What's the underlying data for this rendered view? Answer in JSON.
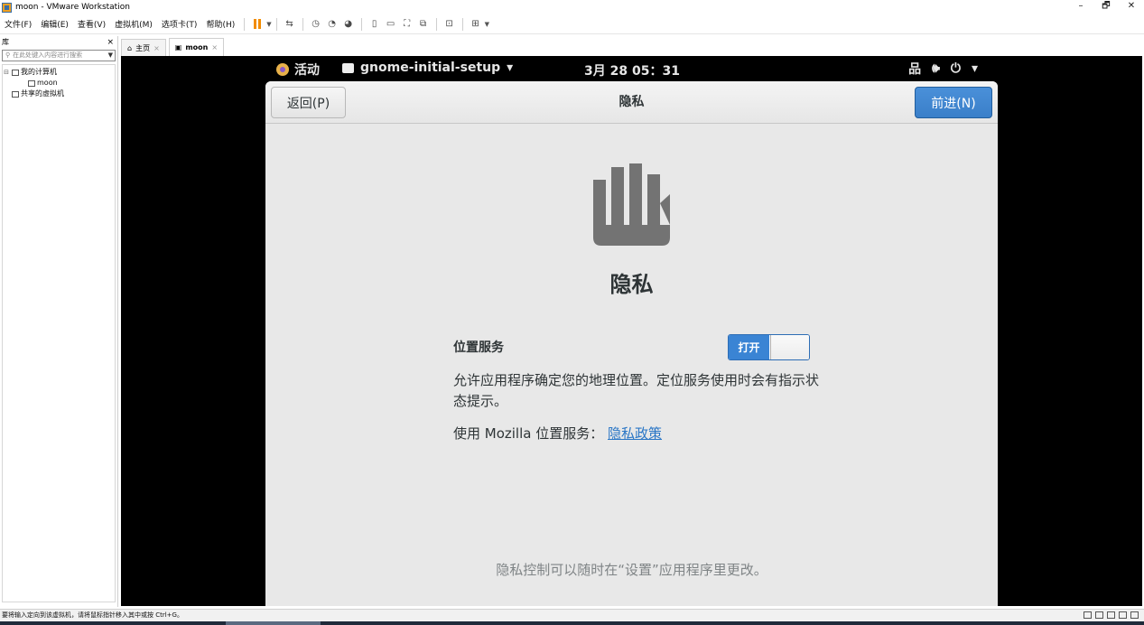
{
  "window": {
    "title": "moon - VMware Workstation",
    "controls": [
      "–",
      "🗗",
      "✕"
    ]
  },
  "menu": {
    "items": [
      "文件(F)",
      "编辑(E)",
      "查看(V)",
      "虚拟机(M)",
      "选项卡(T)",
      "帮助(H)"
    ]
  },
  "library": {
    "title": "库",
    "close": "×",
    "search_placeholder": "在此处键入内容进行搜索",
    "tree": {
      "my_computer": "我的计算机",
      "vm": "moon",
      "shared": "共享的虚拟机"
    }
  },
  "tabs": [
    {
      "label": "主页",
      "close": "×"
    },
    {
      "label": "moon",
      "close": "×"
    }
  ],
  "guest": {
    "topbar": {
      "activities": "活动",
      "app": "gnome-initial-setup",
      "clock": "3月 28  05：31"
    },
    "dialog": {
      "back": "返回(P)",
      "title": "隐私",
      "next": "前进(N)",
      "heading": "隐私",
      "location_label": "位置服务",
      "switch_label": "打开",
      "switch_on": 1,
      "description": "允许应用程序确定您的地理位置。定位服务使用时会有指示状态提示。",
      "mozilla_text": "使用 Mozilla 位置服务：",
      "policy_link": "隐私政策",
      "footnote": "隐私控制可以随时在“设置”应用程序里更改。"
    }
  },
  "statusbar": {
    "text": "要将输入定向到该虚拟机，请将鼠标指针移入其中或按 Ctrl+G。"
  },
  "colors": {
    "accent": "#3a84d4",
    "vm_bg": "#000000",
    "dialog_bg": "#e8e8e8",
    "link": "#2a76c6"
  }
}
